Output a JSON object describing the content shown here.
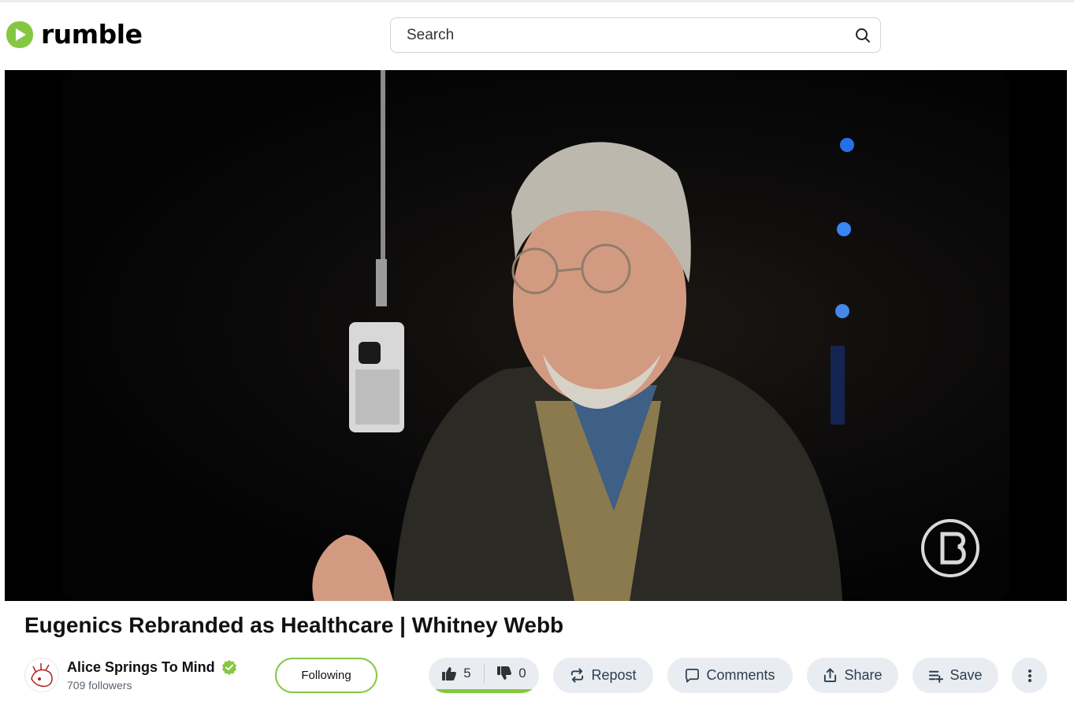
{
  "header": {
    "logo_text": "rumble",
    "brand_color": "#85c742",
    "search_placeholder": "Search"
  },
  "video": {
    "title": "Eugenics Rebranded as Healthcare | Whitney Webb",
    "description_of_frame": ""
  },
  "channel": {
    "name": "Alice Springs To Mind",
    "followers": "709 followers",
    "verified": true,
    "follow_label": "Following"
  },
  "actions": {
    "likes": "5",
    "dislikes": "0",
    "like_ratio": 1.0,
    "repost_label": "Repost",
    "comments_label": "Comments",
    "share_label": "Share",
    "save_label": "Save"
  },
  "icons": [
    "play-logo-icon",
    "search-icon",
    "verified-icon",
    "thumbs-up-icon",
    "thumbs-down-icon",
    "repost-icon",
    "comment-icon",
    "share-icon",
    "save-playlist-icon",
    "more-options-icon"
  ]
}
